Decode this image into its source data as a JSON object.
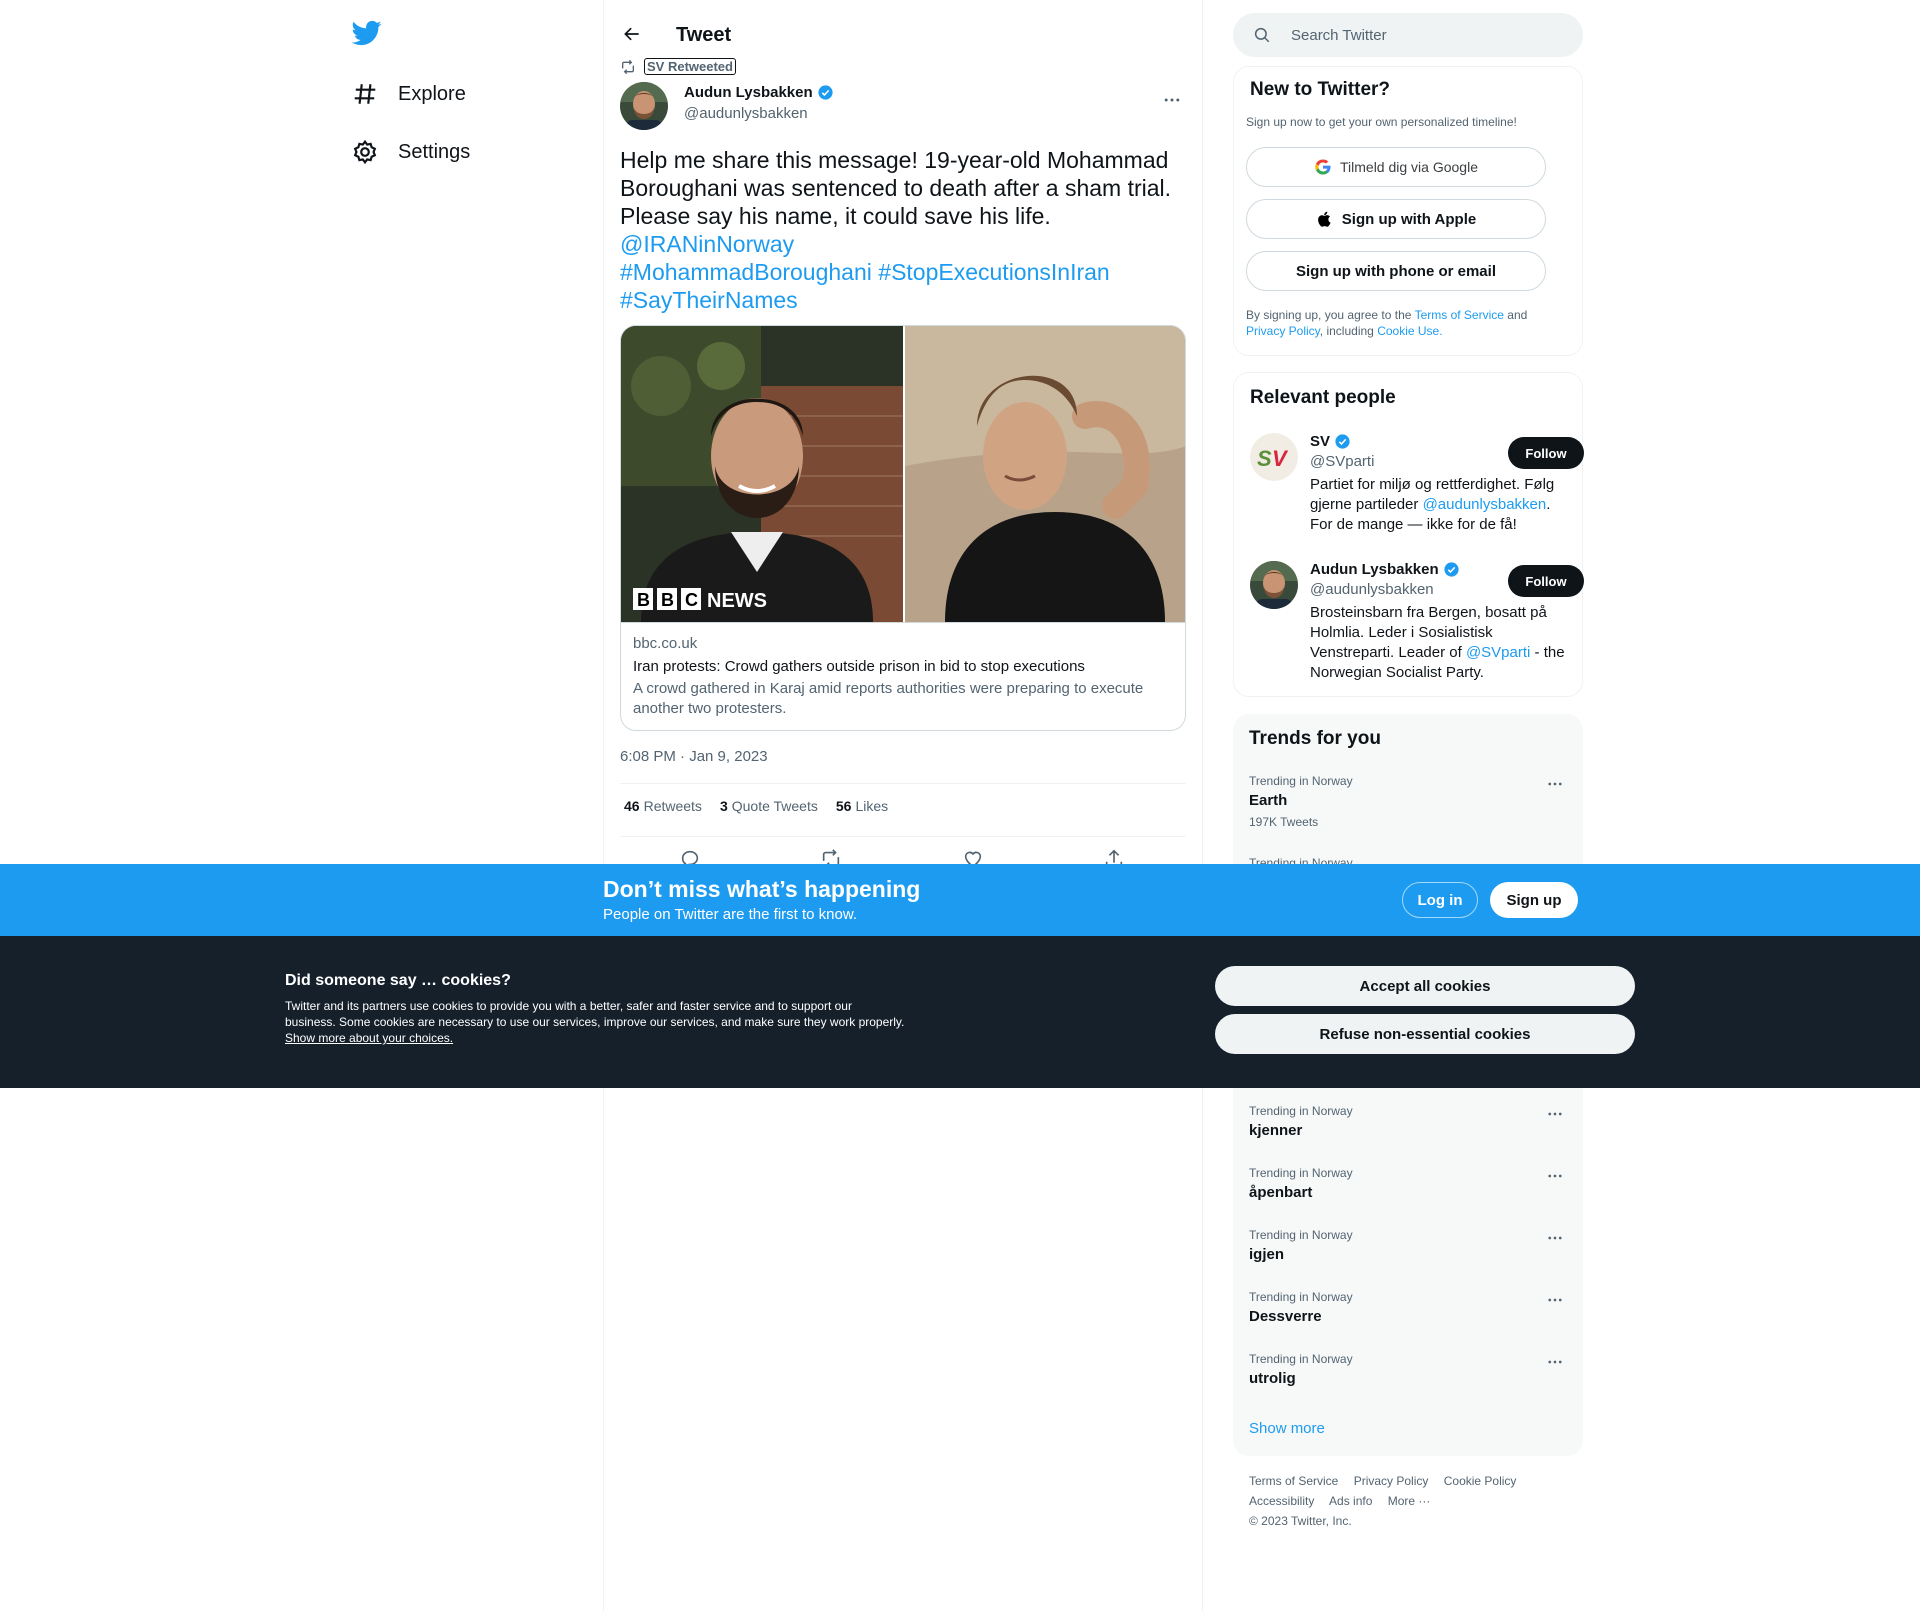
{
  "nav": {
    "items": [
      {
        "label": "Explore",
        "icon": "hashtag-icon"
      },
      {
        "label": "Settings",
        "icon": "gear-icon"
      }
    ]
  },
  "header": {
    "title": "Tweet"
  },
  "tweet": {
    "retweeted_by": "SV Retweeted",
    "author_name": "Audun Lysbakken",
    "author_handle": "@audunlysbakken",
    "text_plain": "Help me share this message! 19-year-old Mohammad Boroughani was sentenced to death after a sham trial. Please say his name, it could save his life.",
    "mention": "@IRANinNorway",
    "hashtag1": "#MohammadBoroughani",
    "hashtag2": "#StopExecutionsInIran",
    "hashtag3": "#SayTheirNames",
    "card": {
      "domain": "bbc.co.uk",
      "title": "Iran protests: Crowd gathers outside prison in bid to stop executions",
      "description": "A crowd gathered in Karaj amid reports authorities were preparing to execute another two protesters.",
      "watermark": "BBC NEWS"
    },
    "timestamp": "6:08 PM · Jan 9, 2023",
    "stats": {
      "retweets_count": "46",
      "retweets_label": "Retweets",
      "quotes_count": "3",
      "quotes_label": "Quote Tweets",
      "likes_count": "56",
      "likes_label": "Likes"
    }
  },
  "search": {
    "placeholder": "Search Twitter"
  },
  "signup_panel": {
    "title": "New to Twitter?",
    "subtitle": "Sign up now to get your own personalized timeline!",
    "google_label": "Tilmeld dig via Google",
    "apple_label": "Sign up with Apple",
    "phone_label": "Sign up with phone or email",
    "terms_prefix": "By signing up, you agree to the",
    "terms_link": "Terms of Service",
    "terms_and": "and",
    "privacy_link": "Privacy Policy",
    "including": ", including",
    "cookie_link": "Cookie Use."
  },
  "relevant_people": {
    "title": "Relevant people",
    "people": [
      {
        "name": "SV",
        "handle": "@SVparti",
        "bio_a": "Partiet for miljø og rettferdighet. Følg gjerne partileder ",
        "bio_link": "@audunlysbakken",
        "bio_b": ". For de mange — ikke for de få!",
        "follow_label": "Follow"
      },
      {
        "name": "Audun Lysbakken",
        "handle": "@audunlysbakken",
        "bio_a": "Brosteinsbarn fra Bergen, bosatt på Holmlia. Leder i Sosialistisk Venstreparti. Leader of ",
        "bio_link": "@SVparti",
        "bio_b": " - the Norwegian Socialist Party.",
        "follow_label": "Follow"
      }
    ]
  },
  "trends": {
    "title": "Trends for you",
    "items": [
      {
        "context": "Trending in Norway",
        "name": "Earth",
        "count": "197K Tweets"
      },
      {
        "context": "Trending in Norway",
        "name": "",
        "count": ""
      },
      {
        "context": "Trending in Norway",
        "name": "kjenner",
        "count": ""
      },
      {
        "context": "Trending in Norway",
        "name": "åpenbart",
        "count": ""
      },
      {
        "context": "Trending in Norway",
        "name": "igjen",
        "count": ""
      },
      {
        "context": "Trending in Norway",
        "name": "Dessverre",
        "count": ""
      },
      {
        "context": "Trending in Norway",
        "name": "utrolig",
        "count": ""
      }
    ],
    "show_more": "Show more"
  },
  "footer": {
    "links_row1": [
      "Terms of Service",
      "Privacy Policy",
      "Cookie Policy"
    ],
    "links_row2": [
      "Accessibility",
      "Ads info",
      "More ···"
    ],
    "copyright": "© 2023 Twitter, Inc."
  },
  "banner": {
    "title": "Don’t miss what’s happening",
    "subtitle": "People on Twitter are the first to know.",
    "login_label": "Log in",
    "signup_label": "Sign up"
  },
  "cookies": {
    "title": "Did someone say … cookies?",
    "text": "Twitter and its partners use cookies to provide you with a better, safer and faster service and to support our business. Some cookies are necessary to use our services, improve our services, and make sure they work properly.",
    "more_link": "Show more about your choices.",
    "accept_label": "Accept all cookies",
    "refuse_label": "Refuse non-essential cookies"
  },
  "colors": {
    "accent": "#1d9bf0",
    "text": "#0f1419",
    "muted": "#536471",
    "cookie_bg": "#15202b"
  }
}
